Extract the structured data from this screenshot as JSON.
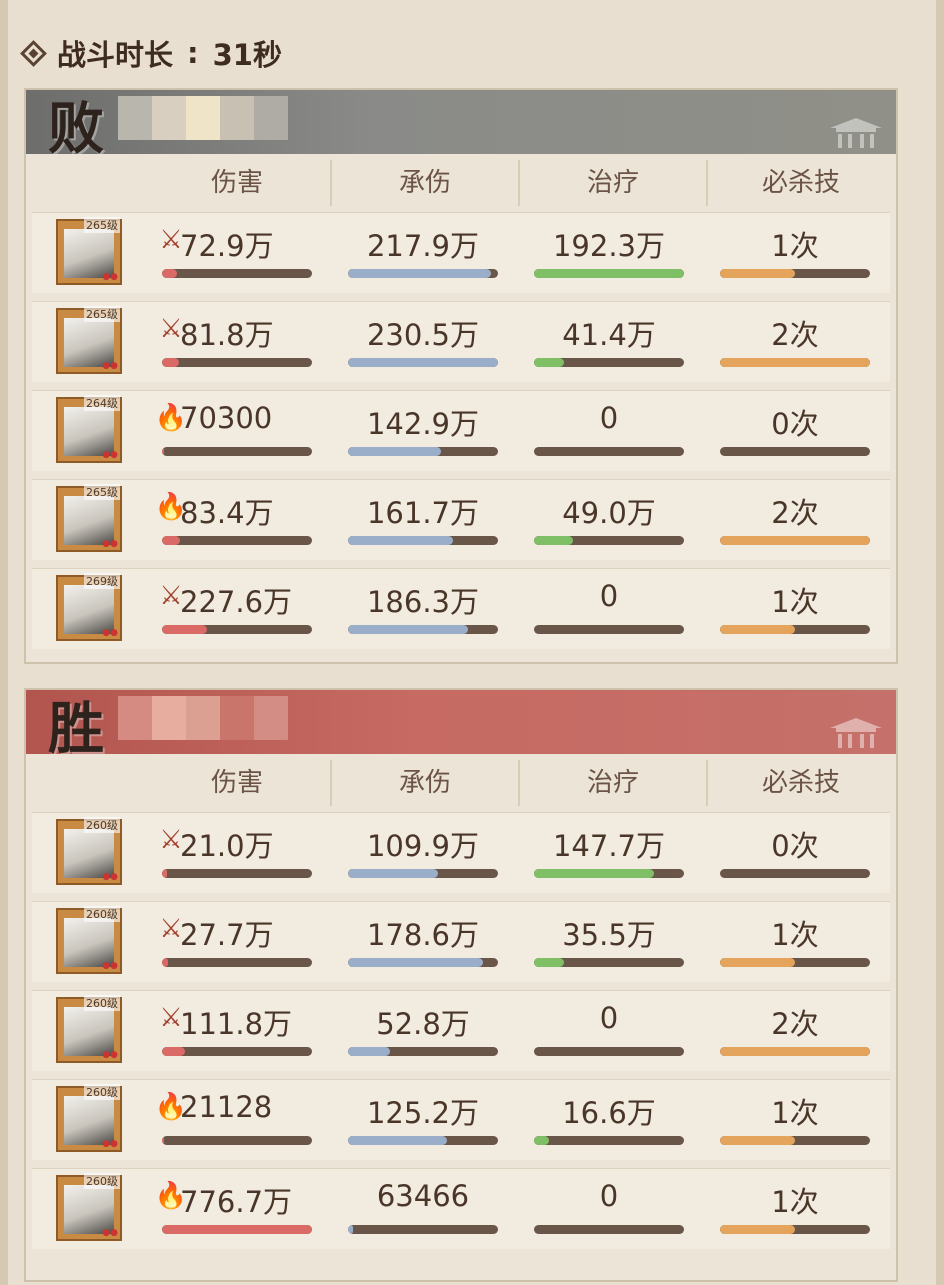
{
  "duration": {
    "label": "战斗时长",
    "separator": ":",
    "value": "31秒"
  },
  "headers": [
    "伤害",
    "承伤",
    "治疗",
    "必杀技"
  ],
  "teams": [
    {
      "result": "败",
      "rows": [
        {
          "level": "265级",
          "damage": "72.9万",
          "damage_icon": "claw-icon",
          "taken": "217.9万",
          "heal": "192.3万",
          "ult": "1次",
          "fills": {
            "damage": 0.1,
            "taken": 0.95,
            "heal": 1.0,
            "ult": 0.5
          }
        },
        {
          "level": "265级",
          "damage": "81.8万",
          "damage_icon": "claw-icon",
          "taken": "230.5万",
          "heal": "41.4万",
          "ult": "2次",
          "fills": {
            "damage": 0.11,
            "taken": 1.0,
            "heal": 0.2,
            "ult": 1.0
          }
        },
        {
          "level": "264级",
          "damage": "70300",
          "damage_icon": "flame-icon",
          "taken": "142.9万",
          "heal": "0",
          "ult": "0次",
          "fills": {
            "damage": 0.01,
            "taken": 0.62,
            "heal": 0.0,
            "ult": 0.0
          }
        },
        {
          "level": "265级",
          "damage": "83.4万",
          "damage_icon": "flame-icon",
          "taken": "161.7万",
          "heal": "49.0万",
          "ult": "2次",
          "fills": {
            "damage": 0.12,
            "taken": 0.7,
            "heal": 0.26,
            "ult": 1.0
          }
        },
        {
          "level": "269级",
          "damage": "227.6万",
          "damage_icon": "claw-icon",
          "taken": "186.3万",
          "heal": "0",
          "ult": "1次",
          "fills": {
            "damage": 0.3,
            "taken": 0.8,
            "heal": 0.0,
            "ult": 0.5
          }
        }
      ]
    },
    {
      "result": "胜",
      "rows": [
        {
          "level": "260级",
          "damage": "21.0万",
          "damage_icon": "claw-icon",
          "taken": "109.9万",
          "heal": "147.7万",
          "ult": "0次",
          "fills": {
            "damage": 0.03,
            "taken": 0.6,
            "heal": 0.8,
            "ult": 0.0
          }
        },
        {
          "level": "260级",
          "damage": "27.7万",
          "damage_icon": "claw-icon",
          "taken": "178.6万",
          "heal": "35.5万",
          "ult": "1次",
          "fills": {
            "damage": 0.04,
            "taken": 0.9,
            "heal": 0.2,
            "ult": 0.5
          }
        },
        {
          "level": "260级",
          "damage": "111.8万",
          "damage_icon": "claw-icon",
          "taken": "52.8万",
          "heal": "0",
          "ult": "2次",
          "fills": {
            "damage": 0.15,
            "taken": 0.28,
            "heal": 0.0,
            "ult": 1.0
          }
        },
        {
          "level": "260级",
          "damage": "21128",
          "damage_icon": "flame-icon",
          "taken": "125.2万",
          "heal": "16.6万",
          "ult": "1次",
          "fills": {
            "damage": 0.01,
            "taken": 0.66,
            "heal": 0.1,
            "ult": 0.5
          }
        },
        {
          "level": "260级",
          "damage": "776.7万",
          "damage_icon": "flame-icon",
          "taken": "63466",
          "heal": "0",
          "ult": "1次",
          "fills": {
            "damage": 1.0,
            "taken": 0.03,
            "heal": 0.0,
            "ult": 0.5
          }
        }
      ]
    }
  ]
}
